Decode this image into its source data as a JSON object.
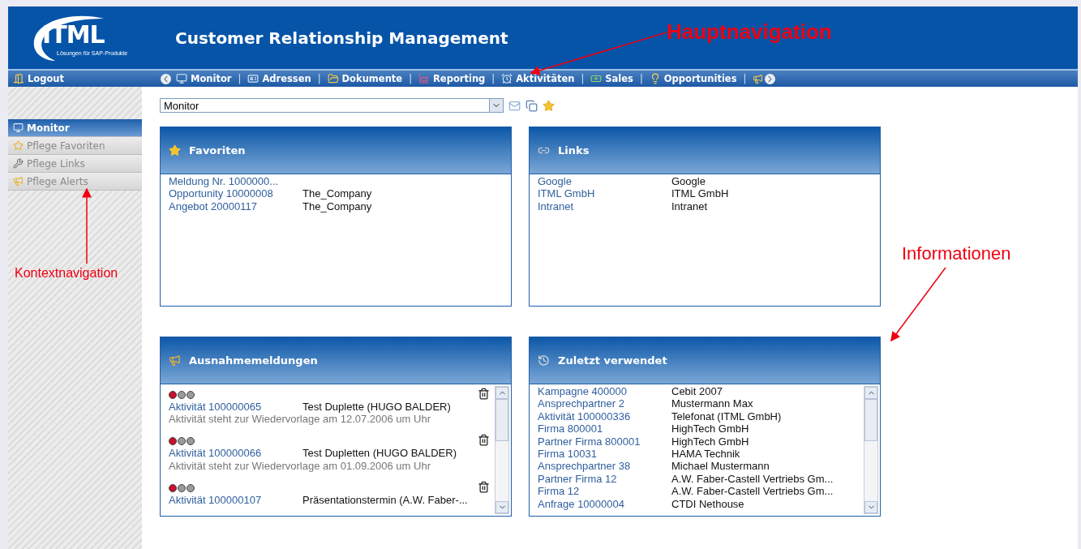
{
  "header": {
    "logo": "ITML",
    "logo_tagline": "Lösungen für SAP-Produkte",
    "title": "Customer Relationship Management"
  },
  "nav": {
    "logout": "Logout",
    "separator": "|",
    "items": [
      {
        "label": "Monitor"
      },
      {
        "label": "Adressen"
      },
      {
        "label": "Dokumente"
      },
      {
        "label": "Reporting"
      },
      {
        "label": "Aktivitäten"
      },
      {
        "label": "Sales"
      },
      {
        "label": "Opportunities"
      }
    ]
  },
  "sidebar": {
    "items": [
      {
        "label": "Monitor",
        "selected": true
      },
      {
        "label": "Pflege Favoriten",
        "selected": false
      },
      {
        "label": "Pflege Links",
        "selected": false
      },
      {
        "label": "Pflege Alerts",
        "selected": false
      }
    ]
  },
  "view_select": {
    "value": "Monitor"
  },
  "panels": [
    {
      "kind": "list",
      "title": "Favoriten",
      "rows": [
        {
          "link": "Meldung Nr. 1000000..."
        },
        {
          "link": "Opportunity 10000008",
          "text": "The_Company"
        },
        {
          "link": "Angebot 20000117",
          "text": "The_Company"
        }
      ]
    },
    {
      "kind": "list",
      "title": "Links",
      "rows": [
        {
          "link": "Google",
          "text": "Google"
        },
        {
          "link": "ITML GmbH",
          "text": "ITML GmbH"
        },
        {
          "link": "Intranet",
          "text": "Intranet"
        }
      ]
    },
    {
      "kind": "alerts",
      "title": "Ausnahmemeldungen",
      "entries": [
        {
          "lights": [
            {
              "color": "#c8102e"
            },
            {
              "color": "#9a9a9a"
            },
            {
              "color": "#9a9a9a"
            }
          ],
          "link": "Aktivität 100000065",
          "text": "Test Duplette (HUGO BALDER)",
          "note": "Aktivität steht zur Wiedervorlage am 12.07.2006 um Uhr"
        },
        {
          "lights": [
            {
              "color": "#c8102e"
            },
            {
              "color": "#9a9a9a"
            },
            {
              "color": "#9a9a9a"
            }
          ],
          "link": "Aktivität 100000066",
          "text": "Test Dupletten (HUGO BALDER)",
          "note": "Aktivität steht zur Wiedervorlage am 01.09.2006 um Uhr"
        },
        {
          "lights": [
            {
              "color": "#c8102e"
            },
            {
              "color": "#9a9a9a"
            },
            {
              "color": "#9a9a9a"
            }
          ],
          "link": "Aktivität 100000107",
          "text": "Präsentationstermin (A.W. Faber-..."
        }
      ]
    },
    {
      "kind": "recent",
      "title": "Zuletzt verwendet",
      "rows": [
        {
          "link": "Kampagne 400000",
          "text": "Cebit 2007"
        },
        {
          "link": "Ansprechpartner 2",
          "text": "Mustermann Max"
        },
        {
          "link": "Aktivität 100000336",
          "text": "Telefonat (ITML GmbH)"
        },
        {
          "link": "Firma 800001",
          "text": "HighTech GmbH"
        },
        {
          "link": "Partner Firma 800001",
          "text": "HighTech GmbH"
        },
        {
          "link": "Firma 10031",
          "text": "HAMA Technik"
        },
        {
          "link": "Ansprechpartner 38",
          "text": "Michael Mustermann"
        },
        {
          "link": "Partner Firma 12",
          "text": "A.W. Faber-Castell Vertriebs Gm..."
        },
        {
          "link": "Firma 12",
          "text": "A.W. Faber-Castell Vertriebs Gm..."
        },
        {
          "link": "Anfrage 10000004",
          "text": "CTDI Nethouse"
        }
      ]
    }
  ],
  "annotations": [
    {
      "text": "Hauptnavigation"
    },
    {
      "text": "Kontextnavigation"
    },
    {
      "text": "Informationen"
    }
  ]
}
